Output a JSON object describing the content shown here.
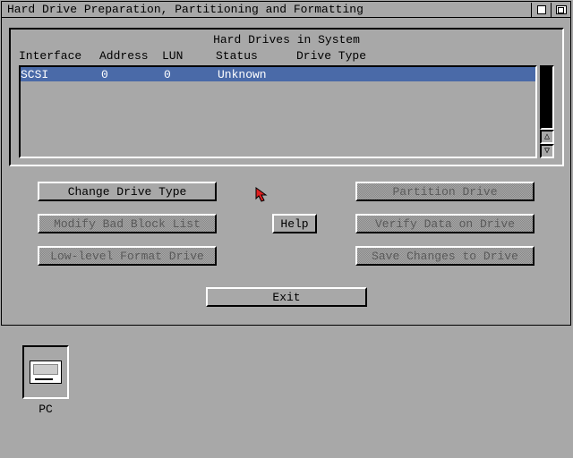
{
  "window": {
    "title": "Hard Drive Preparation, Partitioning and Formatting"
  },
  "panel": {
    "heading": "Hard Drives in System",
    "columns": {
      "interface": "Interface",
      "address": "Address",
      "lun": "LUN",
      "status": "Status",
      "type": "Drive Type"
    }
  },
  "drives": [
    {
      "interface": "SCSI",
      "address": "0",
      "lun": "0",
      "status": "Unknown",
      "type": ""
    }
  ],
  "buttons": {
    "change_type": "Change Drive Type",
    "modify_bad": "Modify Bad Block List",
    "low_level": "Low-level Format Drive",
    "help": "Help",
    "partition": "Partition Drive",
    "verify": "Verify Data on Drive",
    "save": "Save Changes to Drive",
    "exit": "Exit"
  },
  "scroll": {
    "up": "△",
    "down": "▽"
  },
  "desktop": {
    "pc_label": "PC"
  }
}
